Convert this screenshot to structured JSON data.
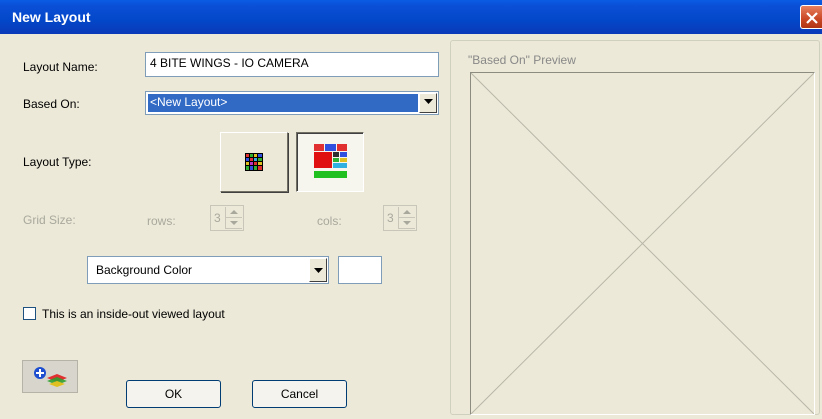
{
  "window": {
    "title": "New Layout"
  },
  "form": {
    "layout_name_label": "Layout Name:",
    "layout_name_value": "4 BITE WINGS - IO CAMERA",
    "based_on_label": "Based On:",
    "based_on_value": "<New Layout>",
    "layout_type_label": "Layout Type:",
    "layout_types": [
      {
        "name": "uniform-grid",
        "selected": false
      },
      {
        "name": "custom-grid",
        "selected": true
      }
    ],
    "grid_size_label": "Grid Size:",
    "rows_label": "rows:",
    "rows_value": "3",
    "cols_label": "cols:",
    "cols_value": "3",
    "background_color_label": "Background Color",
    "background_color": "#ffffff",
    "inside_out_label": "This is an inside-out viewed layout",
    "inside_out_checked": false
  },
  "buttons": {
    "ok": "OK",
    "cancel": "Cancel"
  },
  "preview": {
    "label": "\"Based On\" Preview"
  },
  "colors": {
    "titlebar": "#0a4fd6",
    "selection": "#316ac5",
    "dialog_bg": "#ece9d8",
    "close_button": "#c94624"
  }
}
